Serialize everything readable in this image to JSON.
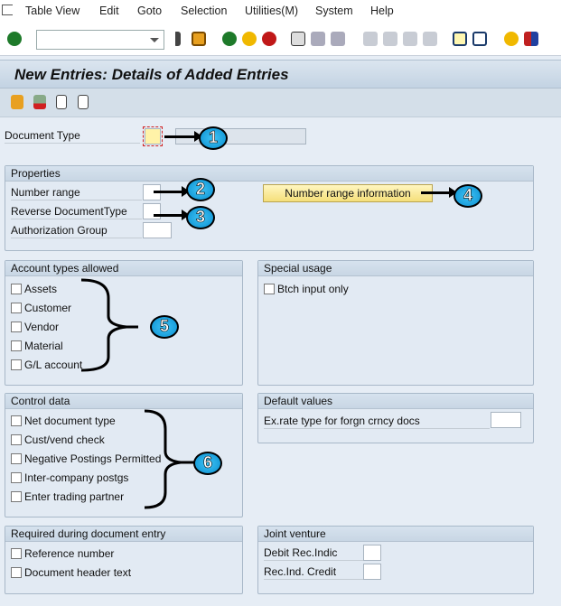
{
  "menu": [
    "Table View",
    "Edit",
    "Goto",
    "Selection",
    "Utilities(M)",
    "System",
    "Help"
  ],
  "toolbar": {
    "command_field": "",
    "icons": [
      "enter-icon",
      "back-arrow-icon",
      "save-icon",
      "back-icon",
      "exit-icon",
      "cancel-icon",
      "print-icon",
      "find-icon",
      "find-next-icon",
      "first-page-icon",
      "previous-page-icon",
      "next-page-icon",
      "last-page-icon",
      "new-session-icon",
      "shortcut-icon",
      "help-icon",
      "layout-icon"
    ]
  },
  "title": "New Entries: Details of Added Entries",
  "app_toolbar": [
    "change-icon",
    "delete-icon",
    "previous-entry-icon",
    "next-entry-icon"
  ],
  "doc_type": {
    "label": "Document Type",
    "value": "",
    "description": ""
  },
  "properties": {
    "title": "Properties",
    "number_range": "Number range",
    "reverse": "Reverse DocumentType",
    "auth": "Authorization Group",
    "button": "Number range information"
  },
  "account_types": {
    "title": "Account types allowed",
    "items": [
      "Assets",
      "Customer",
      "Vendor",
      "Material",
      "G/L account"
    ]
  },
  "special_usage": {
    "title": "Special usage",
    "items": [
      "Btch input only"
    ]
  },
  "control_data": {
    "title": "Control data",
    "items": [
      "Net document type",
      "Cust/vend check",
      "Negative Postings Permitted",
      "Inter-company postgs",
      "Enter trading partner"
    ]
  },
  "default_values": {
    "title": "Default values",
    "exrate": "Ex.rate type for forgn crncy docs"
  },
  "required": {
    "title": "Required during document entry",
    "items": [
      "Reference number",
      "Document header text"
    ]
  },
  "joint_venture": {
    "title": "Joint venture",
    "debit": "Debit Rec.Indic",
    "credit": "Rec.Ind. Credit"
  },
  "annotations": [
    "1",
    "2",
    "3",
    "4",
    "5",
    "6"
  ],
  "colors": {
    "annotation": "#1aa7e6",
    "button": "#f5df7a",
    "required_field": "#fff3a8"
  }
}
